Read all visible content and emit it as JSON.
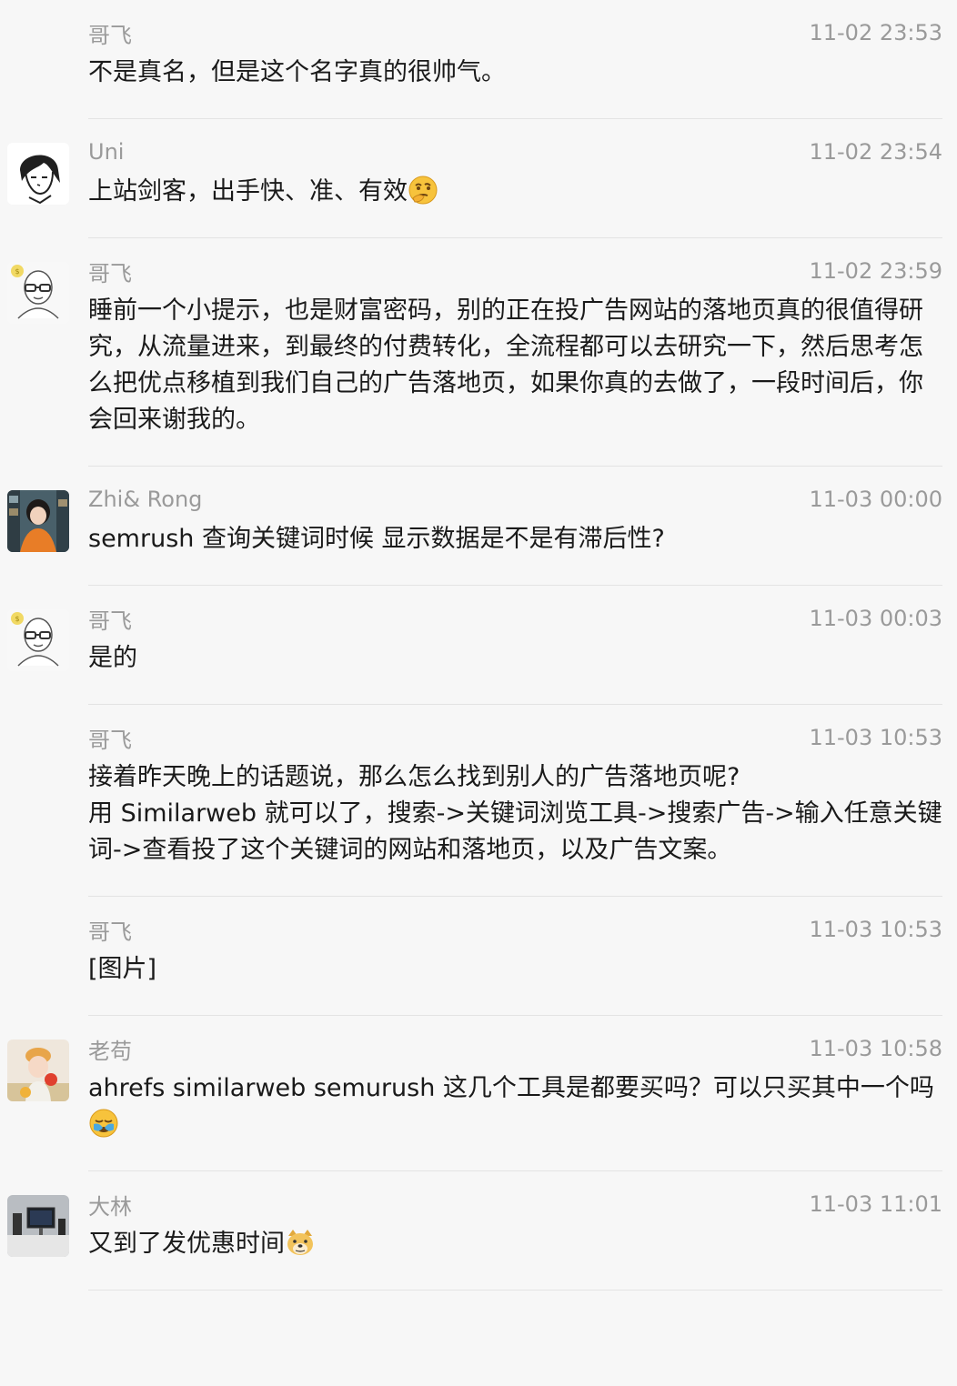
{
  "messages": [
    {
      "sender": "哥飞",
      "time": "11-02 23:53",
      "text": "不是真名，但是这个名字真的很帅气。",
      "avatar": "none",
      "emoji": ""
    },
    {
      "sender": "Uni",
      "time": "11-02 23:54",
      "text": "上站剑客，出手快、准、有效",
      "avatar": "anime-sketch-avatar",
      "emoji": "thinking-face-emoji"
    },
    {
      "sender": "哥飞",
      "time": "11-02 23:59",
      "text": "睡前一个小提示，也是财富密码，别的正在投广告网站的落地页真的很值得研究，从流量进来，到最终的付费转化，全流程都可以去研究一下，然后思考怎么把优点移植到我们自己的广告落地页，如果你真的去做了，一段时间后，你会回来谢我的。",
      "avatar": "glasses-cartoon-avatar",
      "emoji": ""
    },
    {
      "sender": "Zhi& Rong",
      "time": "11-03 00:00",
      "text": "semrush 查询关键词时候 显示数据是不是有滞后性?",
      "avatar": "girl-photo-avatar",
      "emoji": ""
    },
    {
      "sender": "哥飞",
      "time": "11-03 00:03",
      "text": "是的",
      "avatar": "glasses-cartoon-avatar",
      "emoji": ""
    },
    {
      "sender": "哥飞",
      "time": "11-03 10:53",
      "text": "接着昨天晚上的话题说，那么怎么找到别人的广告落地页呢?\n用 Similarweb 就可以了，搜索->关键词浏览工具->搜索广告->输入任意关键词->查看投了这个关键词的网站和落地页，以及广告文案。",
      "avatar": "none",
      "emoji": ""
    },
    {
      "sender": "哥飞",
      "time": "11-03 10:53",
      "text": "[图片]",
      "avatar": "none",
      "emoji": ""
    },
    {
      "sender": "老苟",
      "time": "11-03 10:58",
      "text": "ahrefs similarweb semurush 这几个工具是都要买吗？可以只买其中一个吗",
      "avatar": "child-photo-avatar",
      "emoji": "facepalm-emoji"
    },
    {
      "sender": "大林",
      "time": "11-03 11:01",
      "text": "又到了发优惠时间",
      "avatar": "desk-photo-avatar",
      "emoji": "doge-emoji"
    }
  ]
}
